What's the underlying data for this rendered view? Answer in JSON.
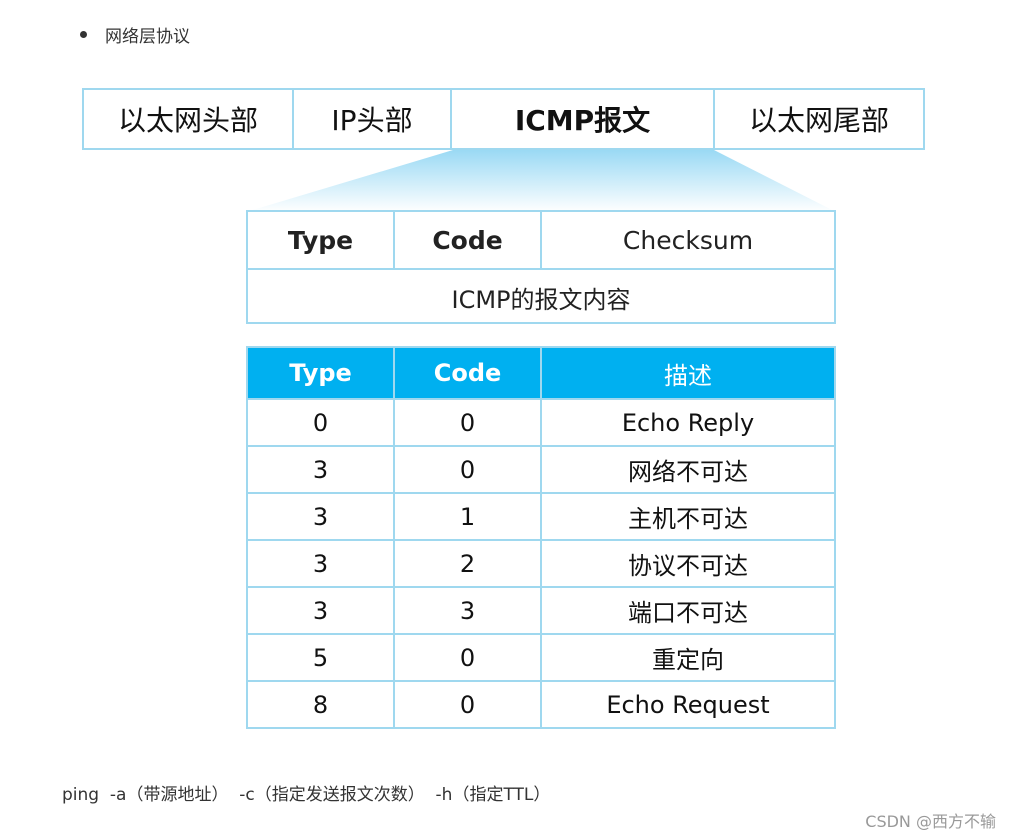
{
  "bullet": {
    "text": "网络层协议"
  },
  "frame": {
    "segments": [
      "以太网头部",
      "IP头部",
      "ICMP报文",
      "以太网尾部"
    ]
  },
  "icmp_header": {
    "fields": [
      "Type",
      "Code",
      "Checksum"
    ],
    "content": "ICMP的报文内容"
  },
  "codes_table": {
    "headers": [
      "Type",
      "Code",
      "描述"
    ],
    "rows": [
      [
        "0",
        "0",
        "Echo Reply"
      ],
      [
        "3",
        "0",
        "网络不可达"
      ],
      [
        "3",
        "1",
        "主机不可达"
      ],
      [
        "3",
        "2",
        "协议不可达"
      ],
      [
        "3",
        "3",
        "端口不可达"
      ],
      [
        "5",
        "0",
        "重定向"
      ],
      [
        "8",
        "0",
        "Echo  Request"
      ]
    ]
  },
  "ping_line": "ping  -a（带源地址）  -c（指定发送报文次数）  -h（指定TTL）",
  "watermark": "CSDN @西方不输",
  "colors": {
    "accent": "#00b0f0",
    "border": "#9fd8ef"
  }
}
